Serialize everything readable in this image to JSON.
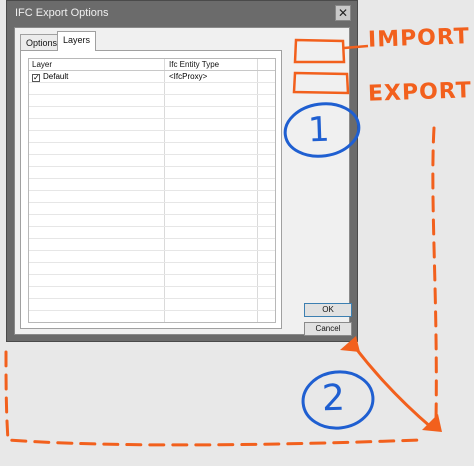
{
  "dialog": {
    "title": "IFC Export Options",
    "close_label": "✕",
    "tabs": [
      {
        "label": "Options"
      },
      {
        "label": "Layers"
      }
    ],
    "table": {
      "headers": [
        "Layer",
        "Ifc Entity Type"
      ],
      "rows": [
        {
          "checked": true,
          "layer": "Default",
          "entity": "<IfcProxy>"
        }
      ]
    },
    "buttons": {
      "ok": "OK",
      "cancel": "Cancel"
    }
  },
  "annotations": {
    "import_label": "IMPORT",
    "export_label": "EXPORT",
    "marker_1": "1",
    "marker_2": "2",
    "colors": {
      "orange": "#f2601d",
      "blue": "#1f5fd1"
    }
  }
}
